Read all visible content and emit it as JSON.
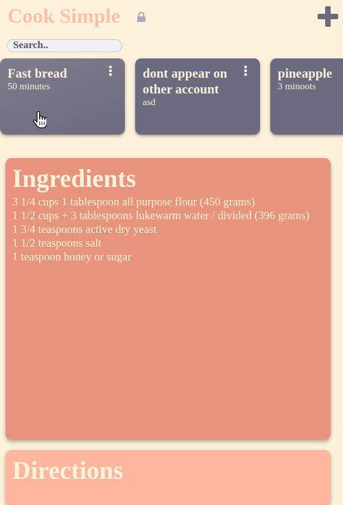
{
  "header": {
    "app_title": "Cook Simple",
    "lock_icon": "lock-icon",
    "add_icon": "plus-icon",
    "title_color": "#fcc0ad"
  },
  "search": {
    "placeholder": "Search..",
    "value": ""
  },
  "recipes": [
    {
      "title": "Fast bread",
      "subtitle": "50 minutes"
    },
    {
      "title": "dont appear on other account",
      "subtitle": "asd"
    },
    {
      "title": "pineapple",
      "subtitle": "3 minoots"
    }
  ],
  "ingredients": {
    "heading": "Ingredients",
    "items": [
      "3 1/4 cups 1 tablespoon all purpose flour (450 grams)",
      "1 1/2 cups + 3 tablespoons lukewarm water / divided (396 grams)",
      "1 3/4 teaspoons active dry yeast",
      "1 1/2 teaspoons salt",
      "1 teaspoon honey or sugar"
    ]
  },
  "directions": {
    "heading": "Directions"
  },
  "colors": {
    "background": "#fcf2dc",
    "card": "#6c6a7e",
    "ingredients_panel": "#e8937c",
    "directions_panel": "#fdb79f"
  }
}
